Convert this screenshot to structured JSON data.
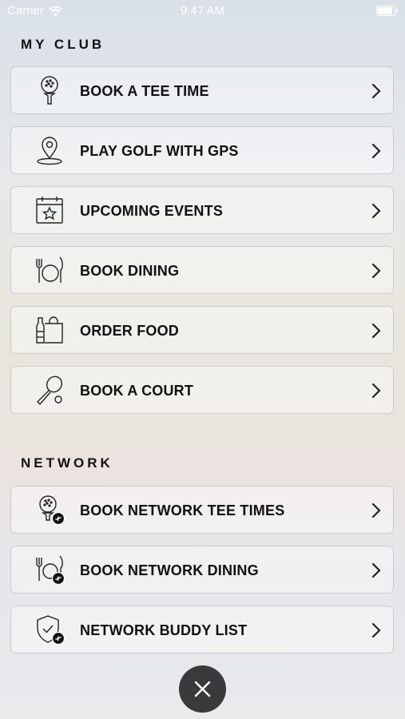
{
  "status_bar": {
    "carrier": "Carrier",
    "time": "9:47 AM",
    "battery_level": 1.0
  },
  "my_club": {
    "title": "MY CLUB",
    "items": [
      {
        "label": "BOOK A TEE TIME",
        "icon": "golf-ball-tee-icon"
      },
      {
        "label": "PLAY GOLF WITH GPS",
        "icon": "map-pin-icon"
      },
      {
        "label": "UPCOMING EVENTS",
        "icon": "calendar-star-icon"
      },
      {
        "label": "BOOK DINING",
        "icon": "fork-plate-knife-icon"
      },
      {
        "label": "ORDER FOOD",
        "icon": "bag-bottle-icon"
      },
      {
        "label": "BOOK A COURT",
        "icon": "racket-ball-icon"
      }
    ]
  },
  "network": {
    "title": "NETWORK",
    "items": [
      {
        "label": "BOOK NETWORK TEE TIMES",
        "icon": "golf-ball-network-icon"
      },
      {
        "label": "BOOK NETWORK DINING",
        "icon": "dining-network-icon"
      },
      {
        "label": "NETWORK BUDDY LIST",
        "icon": "shield-network-icon"
      }
    ]
  },
  "close_button": {
    "icon": "close-icon"
  }
}
